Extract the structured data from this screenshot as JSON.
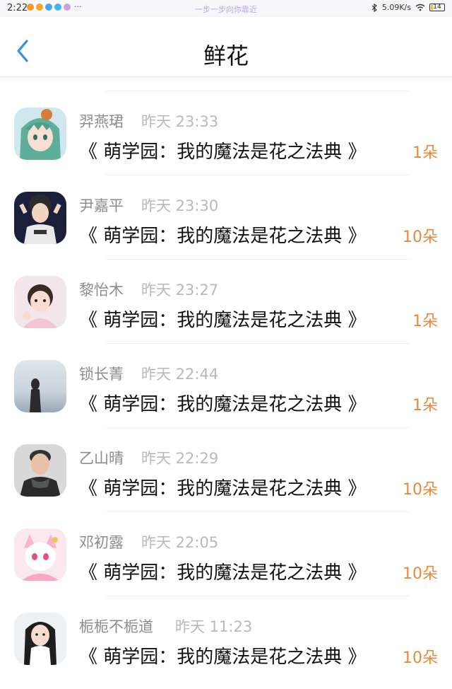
{
  "status_bar": {
    "time": "2:22",
    "more": "···",
    "center_text": "一步一步向你靠近",
    "speed": "5.09K/s",
    "battery": "14",
    "colors": [
      "#f39a2b",
      "#f5a623",
      "#4aa3f0",
      "#3fb5f0",
      "#c9a0dc"
    ]
  },
  "nav": {
    "title": "鲜花",
    "back_icon": "chevron-left-icon",
    "back_color": "#3b8fe0"
  },
  "items": [
    {
      "name": "羿燕珺",
      "time": "昨天 23:33",
      "book": "《 萌学园：我的魔法是花之法典 》",
      "amount": "1朵"
    },
    {
      "name": "尹嘉平",
      "time": "昨天 23:30",
      "book": "《 萌学园：我的魔法是花之法典 》",
      "amount": "10朵"
    },
    {
      "name": "黎怡木",
      "time": "昨天 23:27",
      "book": "《 萌学园：我的魔法是花之法典 》",
      "amount": "1朵"
    },
    {
      "name": "锁长菁",
      "time": "昨天 22:44",
      "book": "《 萌学园：我的魔法是花之法典 》",
      "amount": "1朵"
    },
    {
      "name": "乙山晴",
      "time": "昨天 22:29",
      "book": "《 萌学园：我的魔法是花之法典 》",
      "amount": "10朵"
    },
    {
      "name": "邓初露",
      "time": "昨天 22:05",
      "book": "《 萌学园：我的魔法是花之法典 》",
      "amount": "10朵"
    },
    {
      "name": "栀栀不栀道",
      "time": "昨天 11:23",
      "book": "《 萌学园：我的魔法是花之法典 》",
      "amount": "10朵"
    }
  ],
  "accent_color": "#e58a3c"
}
